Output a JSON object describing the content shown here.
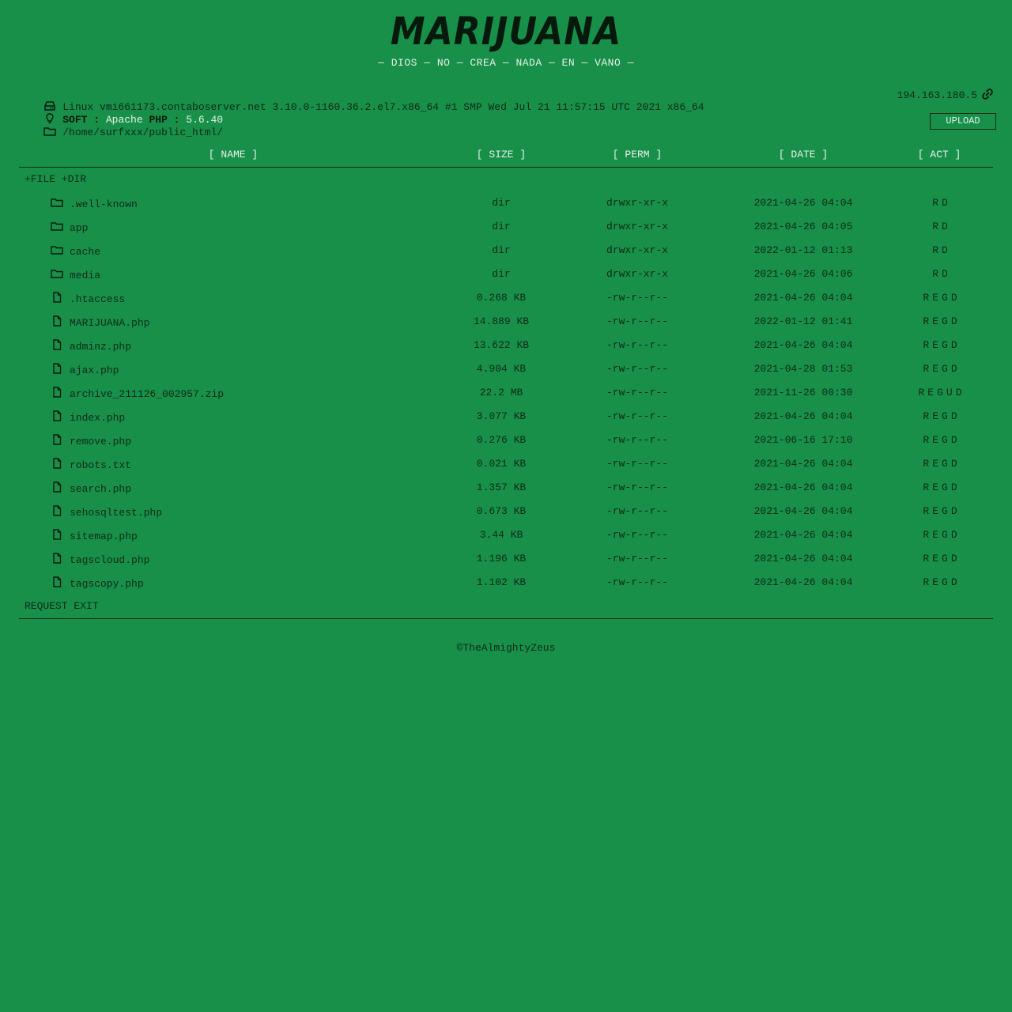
{
  "header": {
    "logo": "MARIJUANA",
    "tagline": "— DIOS — NO — CREA — NADA — EN — VANO —"
  },
  "system": {
    "uname": "Linux vmi661173.contaboserver.net 3.10.0-1160.36.2.el7.x86_64 #1 SMP Wed Jul 21 11:57:15 UTC 2021 x86_64",
    "soft_label": "SOFT :",
    "soft_value": "Apache",
    "php_label": "PHP :",
    "php_value": "5.6.40",
    "path": "/home/surfxxx/public_html/",
    "ip": "194.163.180.5"
  },
  "upload_label": "UPLOAD",
  "columns": {
    "name": "[ NAME ]",
    "size": "[ SIZE ]",
    "perm": "[ PERM ]",
    "date": "[ DATE ]",
    "act": "[ ACT ]"
  },
  "toolbar": {
    "new_file": "+FILE",
    "new_dir": "+DIR"
  },
  "files": [
    {
      "name": ".well-known",
      "type": "dir",
      "size": "dir",
      "perm": "drwxr-xr-x",
      "date": "2021-04-26 04:04",
      "actions": [
        "R",
        "D"
      ]
    },
    {
      "name": "app",
      "type": "dir",
      "size": "dir",
      "perm": "drwxr-xr-x",
      "date": "2021-04-26 04:05",
      "actions": [
        "R",
        "D"
      ]
    },
    {
      "name": "cache",
      "type": "dir",
      "size": "dir",
      "perm": "drwxr-xr-x",
      "date": "2022-01-12 01:13",
      "actions": [
        "R",
        "D"
      ]
    },
    {
      "name": "media",
      "type": "dir",
      "size": "dir",
      "perm": "drwxr-xr-x",
      "date": "2021-04-26 04:06",
      "actions": [
        "R",
        "D"
      ]
    },
    {
      "name": ".htaccess",
      "type": "file",
      "size": "0.268 KB",
      "perm": "-rw-r--r--",
      "date": "2021-04-26 04:04",
      "actions": [
        "R",
        "E",
        "G",
        "D"
      ]
    },
    {
      "name": "MARIJUANA.php",
      "type": "file",
      "size": "14.889 KB",
      "perm": "-rw-r--r--",
      "date": "2022-01-12 01:41",
      "actions": [
        "R",
        "E",
        "G",
        "D"
      ]
    },
    {
      "name": "adminz.php",
      "type": "file",
      "size": "13.622 KB",
      "perm": "-rw-r--r--",
      "date": "2021-04-26 04:04",
      "actions": [
        "R",
        "E",
        "G",
        "D"
      ]
    },
    {
      "name": "ajax.php",
      "type": "file",
      "size": "4.904 KB",
      "perm": "-rw-r--r--",
      "date": "2021-04-28 01:53",
      "actions": [
        "R",
        "E",
        "G",
        "D"
      ]
    },
    {
      "name": "archive_211126_002957.zip",
      "type": "file",
      "size": "22.2 MB",
      "perm": "-rw-r--r--",
      "date": "2021-11-26 00:30",
      "actions": [
        "R",
        "E",
        "G",
        "U",
        "D"
      ]
    },
    {
      "name": "index.php",
      "type": "file",
      "size": "3.077 KB",
      "perm": "-rw-r--r--",
      "date": "2021-04-26 04:04",
      "actions": [
        "R",
        "E",
        "G",
        "D"
      ]
    },
    {
      "name": "remove.php",
      "type": "file",
      "size": "0.276 KB",
      "perm": "-rw-r--r--",
      "date": "2021-06-16 17:10",
      "actions": [
        "R",
        "E",
        "G",
        "D"
      ]
    },
    {
      "name": "robots.txt",
      "type": "file",
      "size": "0.021 KB",
      "perm": "-rw-r--r--",
      "date": "2021-04-26 04:04",
      "actions": [
        "R",
        "E",
        "G",
        "D"
      ]
    },
    {
      "name": "search.php",
      "type": "file",
      "size": "1.357 KB",
      "perm": "-rw-r--r--",
      "date": "2021-04-26 04:04",
      "actions": [
        "R",
        "E",
        "G",
        "D"
      ]
    },
    {
      "name": "sehosqltest.php",
      "type": "file",
      "size": "0.673 KB",
      "perm": "-rw-r--r--",
      "date": "2021-04-26 04:04",
      "actions": [
        "R",
        "E",
        "G",
        "D"
      ]
    },
    {
      "name": "sitemap.php",
      "type": "file",
      "size": "3.44 KB",
      "perm": "-rw-r--r--",
      "date": "2021-04-26 04:04",
      "actions": [
        "R",
        "E",
        "G",
        "D"
      ]
    },
    {
      "name": "tagscloud.php",
      "type": "file",
      "size": "1.196 KB",
      "perm": "-rw-r--r--",
      "date": "2021-04-26 04:04",
      "actions": [
        "R",
        "E",
        "G",
        "D"
      ]
    },
    {
      "name": "tagscopy.php",
      "type": "file",
      "size": "1.102 KB",
      "perm": "-rw-r--r--",
      "date": "2021-04-26 04:04",
      "actions": [
        "R",
        "E",
        "G",
        "D"
      ]
    }
  ],
  "exit_label": "REQUEST EXIT",
  "footer": "©TheAlmightyZeus",
  "colors": {
    "background": "#18904a",
    "text_dark": "#0d2a17",
    "text_light": "#e6f2e8"
  },
  "icons": {
    "server": "hdd-icon",
    "soft": "lightbulb-icon",
    "path": "folder-icon",
    "ip": "link-icon",
    "dir": "folder-icon",
    "file": "file-icon"
  }
}
